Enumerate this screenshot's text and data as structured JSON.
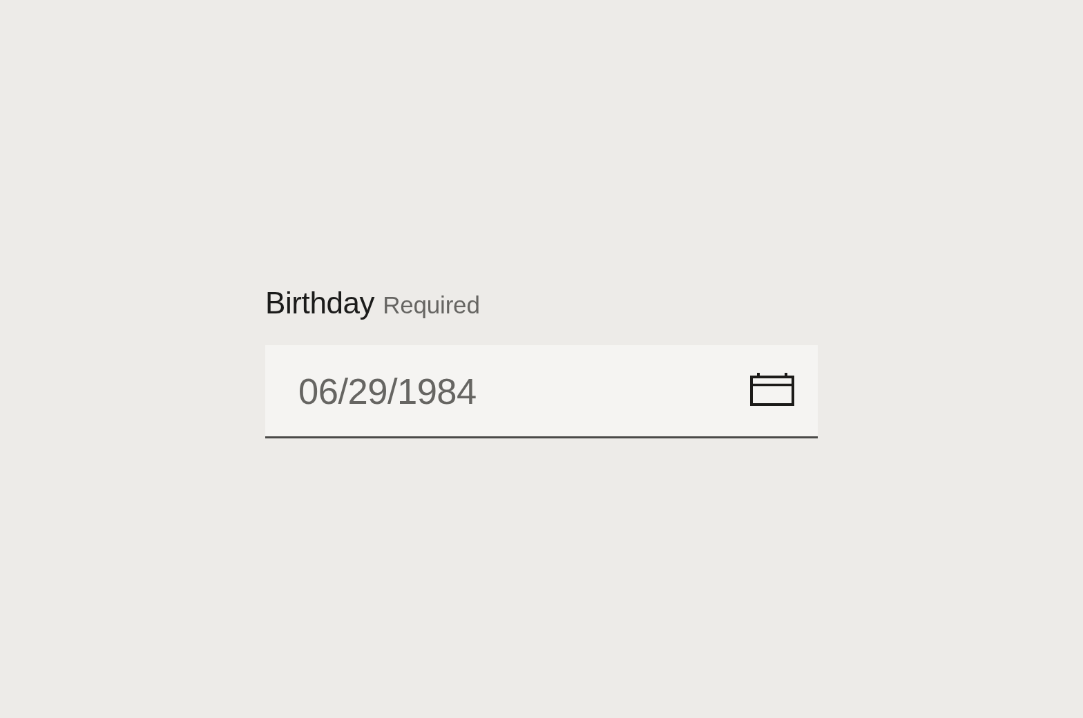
{
  "date_field": {
    "label": "Birthday",
    "hint": "Required",
    "value": "06/29/1984"
  }
}
